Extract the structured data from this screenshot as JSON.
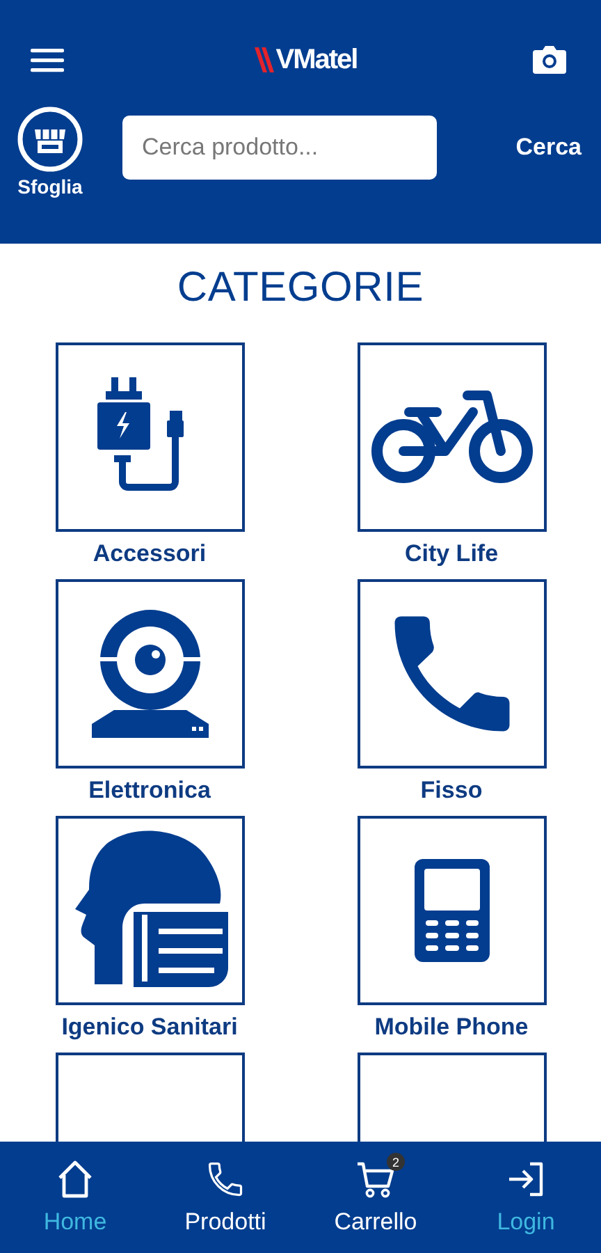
{
  "header": {
    "logo": "VMatel"
  },
  "browse": {
    "label": "Sfoglia"
  },
  "search": {
    "placeholder": "Cerca prodotto...",
    "button": "Cerca"
  },
  "title": "CATEGORIE",
  "categories": [
    {
      "kind": "tile",
      "label": "Accessori"
    },
    {
      "kind": "tile",
      "label": "City Life"
    },
    {
      "kind": "tile",
      "label": "Elettronica"
    },
    {
      "kind": "tile",
      "label": "Fisso"
    },
    {
      "kind": "tile",
      "label": "Igenico Sanitari"
    },
    {
      "kind": "tile",
      "label": "Mobile Phone"
    },
    {
      "kind": "cut"
    },
    {
      "kind": "cut"
    }
  ],
  "nav": [
    {
      "label": "Home",
      "selected": true
    },
    {
      "label": "Prodotti",
      "selected": false
    },
    {
      "label": "Carrello",
      "selected": false,
      "badge": "2"
    },
    {
      "label": "Login",
      "selected": true
    }
  ]
}
